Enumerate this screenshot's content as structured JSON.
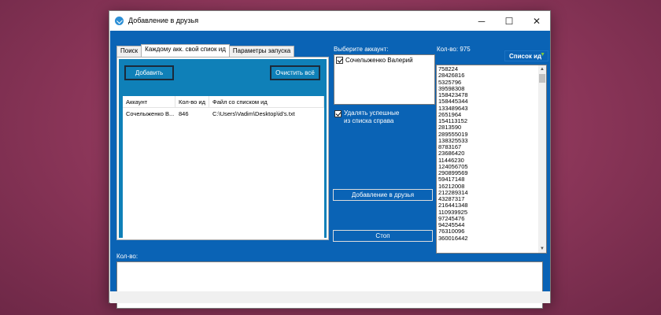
{
  "window": {
    "title": "Добавление в друзья",
    "minimize": "─",
    "maximize": "☐",
    "close": "✕"
  },
  "tabs": [
    {
      "label": "Поиск"
    },
    {
      "label": "Каждому акк. свой спиок ид"
    },
    {
      "label": "Параметры запуска"
    }
  ],
  "tab_panel": {
    "add_button": "Добавить",
    "clear_button": "Очистить всё",
    "table": {
      "headers": [
        "Аккаунт",
        "Кол-во ид",
        "Файл со списком ид"
      ],
      "rows": [
        [
          "Сочелыженко В...",
          "846",
          "C:\\Users\\Vadim\\Desktop\\id's.txt"
        ]
      ]
    }
  },
  "accounts": {
    "label": "Выберите аккаунт:",
    "items": [
      {
        "name": "Сочелыженко Валерий",
        "checked": true
      }
    ]
  },
  "remove_successful": {
    "label_line1": "Удалять успешные",
    "label_line2": "из списка справа",
    "checked": true
  },
  "add_friends_button": "Добавление в друзья",
  "stop_button": "Стоп",
  "ids_panel": {
    "count_label": "Кол-во: 975",
    "list_type": "Список ид",
    "ids": [
      "758224",
      "28426816",
      "5325796",
      "39598308",
      "158423478",
      "158445344",
      "133489643",
      "2651964",
      "154113152",
      "2813590",
      "289555019",
      "138325533",
      "8783167",
      "23686420",
      "11446230",
      "124056705",
      "290899569",
      "59417148",
      "16212008",
      "212289314",
      "43287317",
      "216441348",
      "110939925",
      "97245476",
      "94245544",
      "76310096",
      "360016442"
    ]
  },
  "log": {
    "label": "Кол-во:"
  },
  "colors": {
    "client_bg": "#0a63b5",
    "tab_inner_bg": "#0f80b8",
    "select_arrow": "#7ecb3a"
  }
}
